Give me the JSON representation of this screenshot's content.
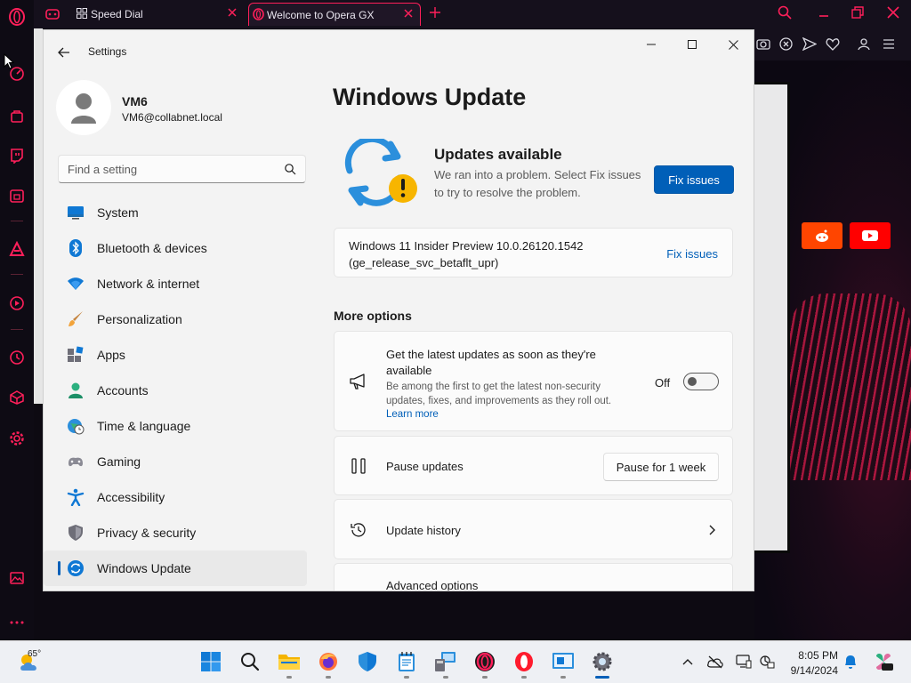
{
  "browser": {
    "tabs": [
      {
        "label": "Speed Dial"
      },
      {
        "label": "Welcome to Opera GX"
      }
    ],
    "speed_dial_tiles": [
      {
        "name": "reddit",
        "color": "#ff4500"
      },
      {
        "name": "youtube",
        "color": "#ff0000"
      }
    ],
    "accent": "#ff1f5a"
  },
  "settings": {
    "window_title": "Settings",
    "user": {
      "name": "VM6",
      "email": "VM6@collabnet.local"
    },
    "search": {
      "placeholder": "Find a setting"
    },
    "nav": [
      {
        "label": "System",
        "icon": "monitor-icon"
      },
      {
        "label": "Bluetooth & devices",
        "icon": "bluetooth-icon"
      },
      {
        "label": "Network & internet",
        "icon": "wifi-icon"
      },
      {
        "label": "Personalization",
        "icon": "brush-icon"
      },
      {
        "label": "Apps",
        "icon": "apps-icon"
      },
      {
        "label": "Accounts",
        "icon": "person-icon"
      },
      {
        "label": "Time & language",
        "icon": "globe-clock-icon"
      },
      {
        "label": "Gaming",
        "icon": "gamepad-icon"
      },
      {
        "label": "Accessibility",
        "icon": "accessibility-icon"
      },
      {
        "label": "Privacy & security",
        "icon": "shield-icon"
      },
      {
        "label": "Windows Update",
        "icon": "update-icon",
        "selected": true
      }
    ],
    "page_title": "Windows Update",
    "status": {
      "title": "Updates available",
      "description": "We ran into a problem. Select Fix issues to try to resolve the problem.",
      "button": "Fix issues"
    },
    "pending_update": {
      "name": "Windows 11 Insider Preview 10.0.26120.1542",
      "branch": "(ge_release_svc_betaflt_upr)",
      "action": "Fix issues"
    },
    "more_options": {
      "heading": "More options",
      "latest": {
        "title": "Get the latest updates as soon as they're available",
        "description": "Be among the first to get the latest non-security updates, fixes, and improvements as they roll out.",
        "link": "Learn more",
        "toggle_label": "Off",
        "toggle_on": false
      },
      "pause": {
        "title": "Pause updates",
        "button": "Pause for 1 week"
      },
      "history": {
        "title": "Update history"
      },
      "advanced": {
        "title": "Advanced options"
      }
    },
    "accent_color": "#005fb8"
  },
  "taskbar": {
    "weather_temp": "65°",
    "clock_time": "8:05 PM",
    "clock_date": "9/14/2024",
    "apps": [
      "start-icon",
      "search-icon",
      "file-explorer-icon",
      "firefox-icon",
      "defender-icon",
      "notepad-icon",
      "remote-desktop-icon",
      "opera-gx-icon",
      "opera-icon",
      "vm-connect-icon",
      "settings-icon"
    ],
    "tray": [
      "chevron-up-icon",
      "network-off-icon",
      "display-icon",
      "battery-saver-icon",
      "bell-icon",
      "copilot-icon"
    ]
  }
}
